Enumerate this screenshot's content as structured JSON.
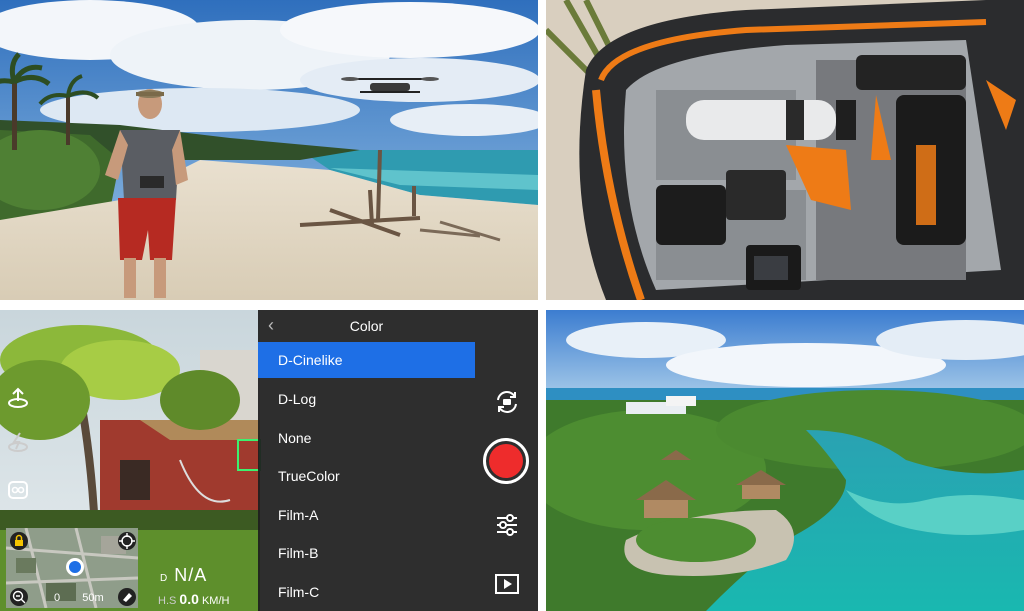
{
  "camera_ui": {
    "menu": {
      "title": "Color",
      "items": [
        "D-Cinelike",
        "D-Log",
        "None",
        "TrueColor",
        "Film-A",
        "Film-B",
        "Film-C"
      ],
      "selected_index": 0
    },
    "map": {
      "scale_label": "50m",
      "scale_zero": "0"
    },
    "telemetry": {
      "distance_label": "D",
      "distance_value": "N/A",
      "hspeed_label": "H.S",
      "hspeed_value": "0.0",
      "hspeed_unit": "KM/H"
    }
  },
  "colors": {
    "accent": "#1e6fe6",
    "record": "#ee2c2c",
    "panel_bg": "#1e1e1e"
  },
  "icons": [
    "back-chevron-icon",
    "camera-switch-icon",
    "record-button",
    "settings-sliders-icon",
    "playback-icon",
    "takeoff-icon",
    "return-home-icon",
    "remote-controller-icon",
    "lock-icon",
    "target-icon",
    "zoom-out-icon",
    "eraser-icon",
    "location-pin-icon"
  ]
}
